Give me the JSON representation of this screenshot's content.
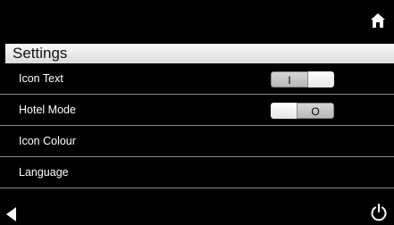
{
  "top_bar": {
    "home_icon": "home-icon"
  },
  "header": {
    "title": "Settings"
  },
  "settings": {
    "items": [
      {
        "label": "Icon Text",
        "toggle_text": "I",
        "toggle_state": "on"
      },
      {
        "label": "Hotel Mode",
        "toggle_text": "O",
        "toggle_state": "off"
      },
      {
        "label": "Icon Colour"
      },
      {
        "label": "Language"
      }
    ]
  },
  "bottom_bar": {
    "back_icon": "back-arrow-icon",
    "power_icon": "power-icon"
  },
  "colors": {
    "background": "#000000",
    "header_bg": "#ececec",
    "toggle_bg": "#c8c8c8",
    "divider": "#8a8a8a"
  }
}
